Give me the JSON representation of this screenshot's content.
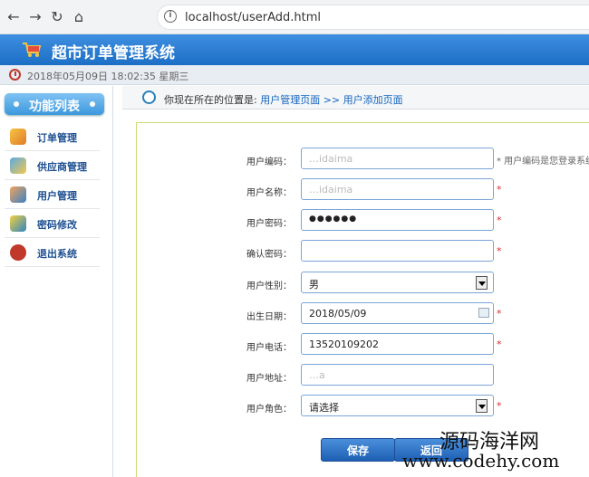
{
  "browser": {
    "url": "localhost/userAdd.html"
  },
  "header": {
    "title": "超市订单管理系统"
  },
  "timebar": {
    "datetime": "2018年05月09日 18:02:35 星期三"
  },
  "sidebar": {
    "title": "功能列表",
    "items": [
      {
        "label": "订单管理",
        "icon": "order-icon"
      },
      {
        "label": "供应商管理",
        "icon": "provider-icon"
      },
      {
        "label": "用户管理",
        "icon": "user-icon"
      },
      {
        "label": "密码修改",
        "icon": "password-icon"
      },
      {
        "label": "退出系统",
        "icon": "exit-icon"
      }
    ]
  },
  "breadcrumb": {
    "prefix": "你现在所在的位置是:",
    "path": "用户管理页面 >> 用户添加页面"
  },
  "form": {
    "rows": [
      {
        "label": "用户编码：",
        "value": "…idaima",
        "hint": "* 用户编码是您登录系统"
      },
      {
        "label": "用户名称：",
        "value": "…idaima",
        "hint": "*"
      },
      {
        "label": "用户密码：",
        "value": "●●●●●●",
        "hint": "*"
      },
      {
        "label": "确认密码：",
        "value": "",
        "hint": "*"
      },
      {
        "label": "用户性别：",
        "value": "男",
        "hint": ""
      },
      {
        "label": "出生日期：",
        "value": "2018/05/09",
        "hint": "*"
      },
      {
        "label": "用户电话：",
        "value": "13520109202",
        "hint": "*"
      },
      {
        "label": "用户地址：",
        "value": "…a",
        "hint": ""
      },
      {
        "label": "用户角色：",
        "value": "请选择",
        "hint": "*"
      }
    ],
    "save_label": "保存",
    "back_label": "返回"
  },
  "watermark": {
    "line1": "源码海洋网",
    "line2": "www.codehy.com"
  },
  "colors": {
    "header": "#1d6fc6",
    "accent": "#3c98dd",
    "required": "#d32f2f"
  }
}
